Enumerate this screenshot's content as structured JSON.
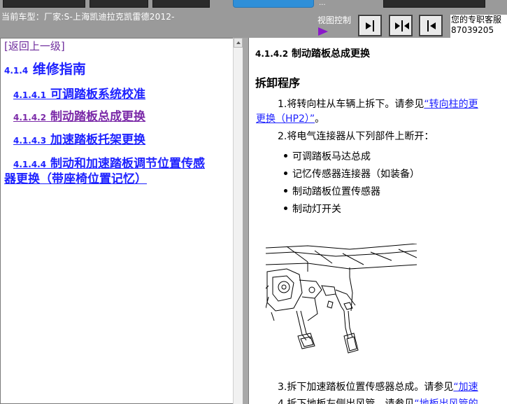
{
  "header": {
    "breadcrumb": "当前车型：厂家:S-上海凯迪拉克凯雷德2012-",
    "view_control_label": "视图控制",
    "small_link": "...",
    "advisor_line1": "您的专职客服",
    "advisor_line2": "87039205",
    "colors": {
      "bar": "#9a9a9a",
      "accent_button": "#2f8fd8",
      "arrow": "#8a18c9"
    }
  },
  "nav": {
    "back_label": "[返回上一级]",
    "root": {
      "number": "4.1.4",
      "title": "维修指南"
    },
    "items": [
      {
        "number": "4.1.4.1",
        "title": "可调踏板系统校准"
      },
      {
        "number": "4.1.4.2",
        "title": "制动踏板总成更换"
      },
      {
        "number": "4.1.4.3",
        "title": "加速踏板托架更换"
      },
      {
        "number": "4.1.4.4",
        "title": "制动和加速踏板调节位置传感",
        "title_cont": "器更换（带座椅位置记忆）"
      }
    ]
  },
  "content": {
    "title_number": "4.1.4.2",
    "title": "制动踏板总成更换",
    "section_heading": "拆卸程序",
    "step1_text": "1.将转向柱从车辆上拆下。请参见",
    "step1_link": "“转向柱的更",
    "step1_link_cont": "更换（HP2）”",
    "step1_end": "。",
    "step2_text": "2.将电气连接器从下列部件上断开：",
    "bullets": [
      "可调踏板马达总成",
      "记忆传感器连接器（如装备）",
      "制动踏板位置传感器",
      "制动灯开关"
    ],
    "step3_text": "3.拆下加速踏板位置传感器总成。请参见",
    "step3_link": "“加速",
    "step4_text": "4.拆下地板左侧出风管。请参见",
    "step4_link": "“地板出风管的"
  }
}
